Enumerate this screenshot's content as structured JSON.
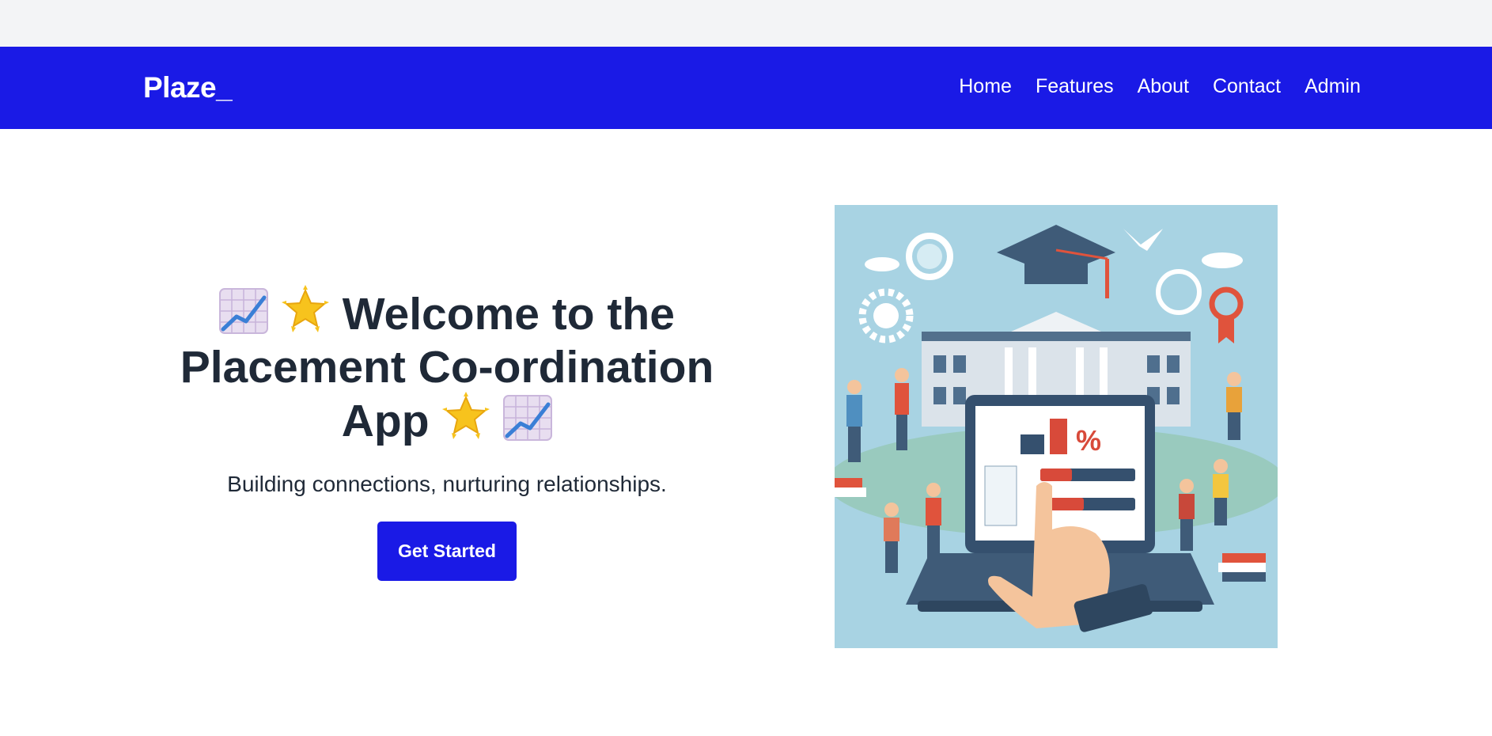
{
  "nav": {
    "brand": "Plaze_",
    "links": [
      "Home",
      "Features",
      "About",
      "Contact",
      "Admin"
    ]
  },
  "hero": {
    "title_line1": "Welcome to the",
    "title_line2": "Placement Co-ordination",
    "title_line3": "App",
    "subtitle": "Building connections, nurturing relationships.",
    "cta_label": "Get Started",
    "image_icon": "placement-illustration",
    "decor_icons": [
      "chart-increasing-icon",
      "glowing-star-icon"
    ]
  },
  "colors": {
    "primary": "#1a1ae6",
    "top_strip": "#f3f4f6",
    "heading": "#1f2937",
    "image_bg": "#a8d3e3"
  }
}
